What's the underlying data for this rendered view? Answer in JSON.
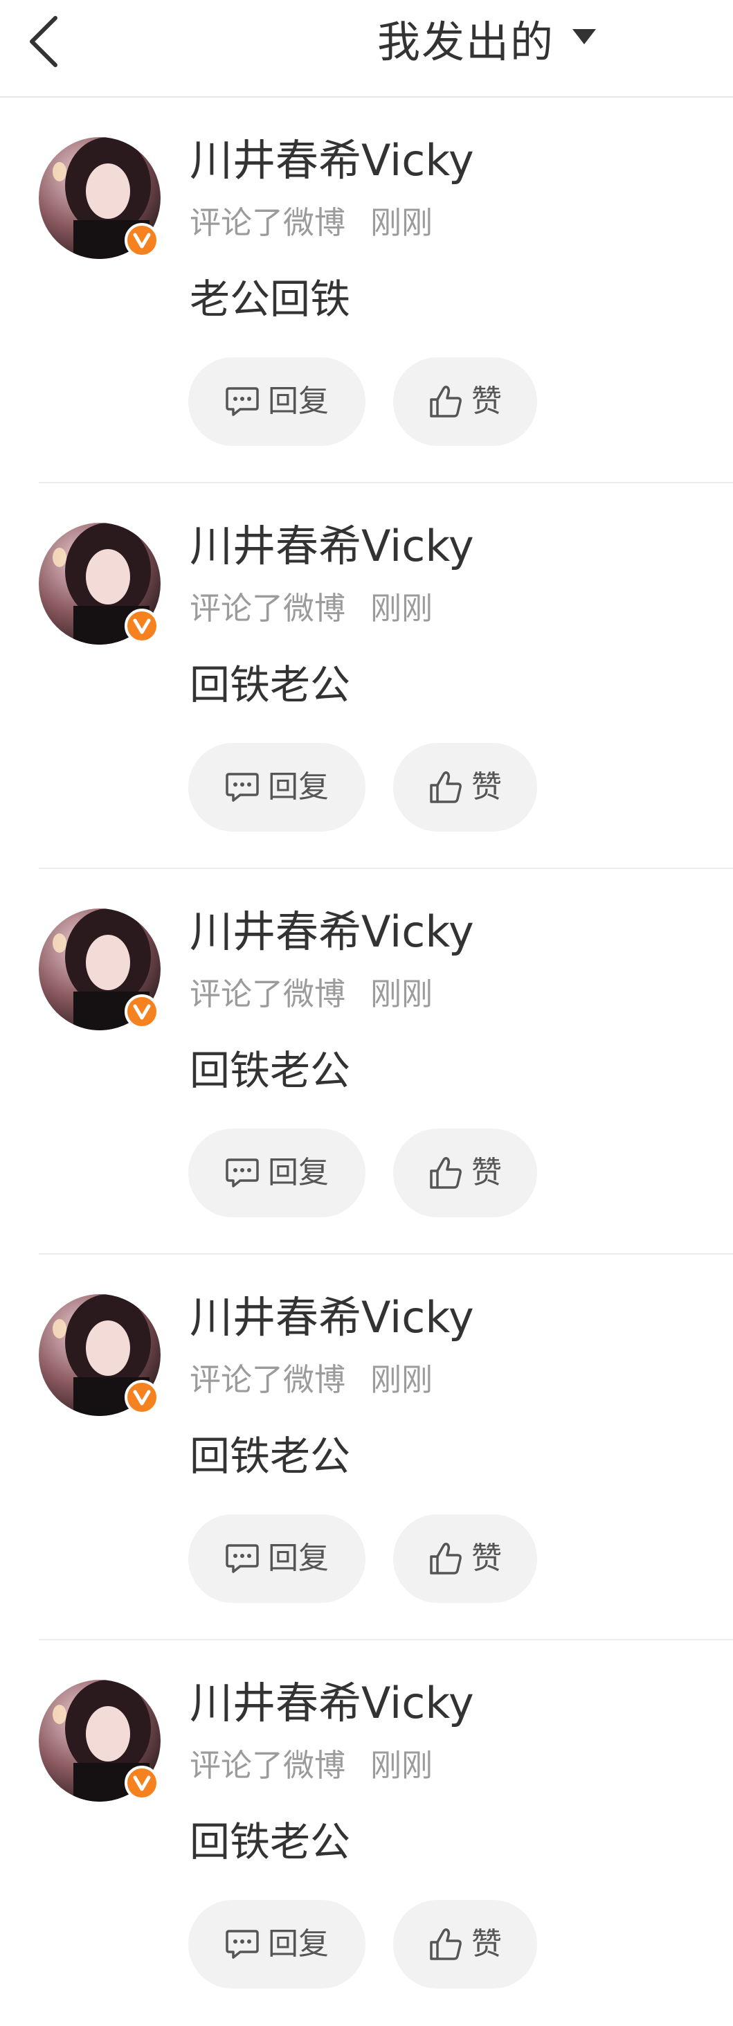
{
  "header": {
    "title": "我发出的"
  },
  "items": [
    {
      "user_name": "川井春希Vicky",
      "action": "评论了微博",
      "time": "刚刚",
      "content": "老公回铁",
      "reply_label": "回复",
      "like_label": "赞"
    },
    {
      "user_name": "川井春希Vicky",
      "action": "评论了微博",
      "time": "刚刚",
      "content": "回铁老公",
      "reply_label": "回复",
      "like_label": "赞"
    },
    {
      "user_name": "川井春希Vicky",
      "action": "评论了微博",
      "time": "刚刚",
      "content": "回铁老公",
      "reply_label": "回复",
      "like_label": "赞"
    },
    {
      "user_name": "川井春希Vicky",
      "action": "评论了微博",
      "time": "刚刚",
      "content": "回铁老公",
      "reply_label": "回复",
      "like_label": "赞"
    },
    {
      "user_name": "川井春希Vicky",
      "action": "评论了微博",
      "time": "刚刚",
      "content": "回铁老公",
      "reply_label": "回复",
      "like_label": "赞"
    }
  ],
  "colors": {
    "badge_orange": "#f5811f",
    "meta_gray": "#9b9b9b",
    "button_bg": "#f2f2f2"
  },
  "icons": {
    "back": "chevron-left-icon",
    "caret": "caret-down-icon",
    "reply": "comment-bubble-icon",
    "like": "thumbs-up-icon",
    "verified": "verified-v-badge-icon"
  }
}
